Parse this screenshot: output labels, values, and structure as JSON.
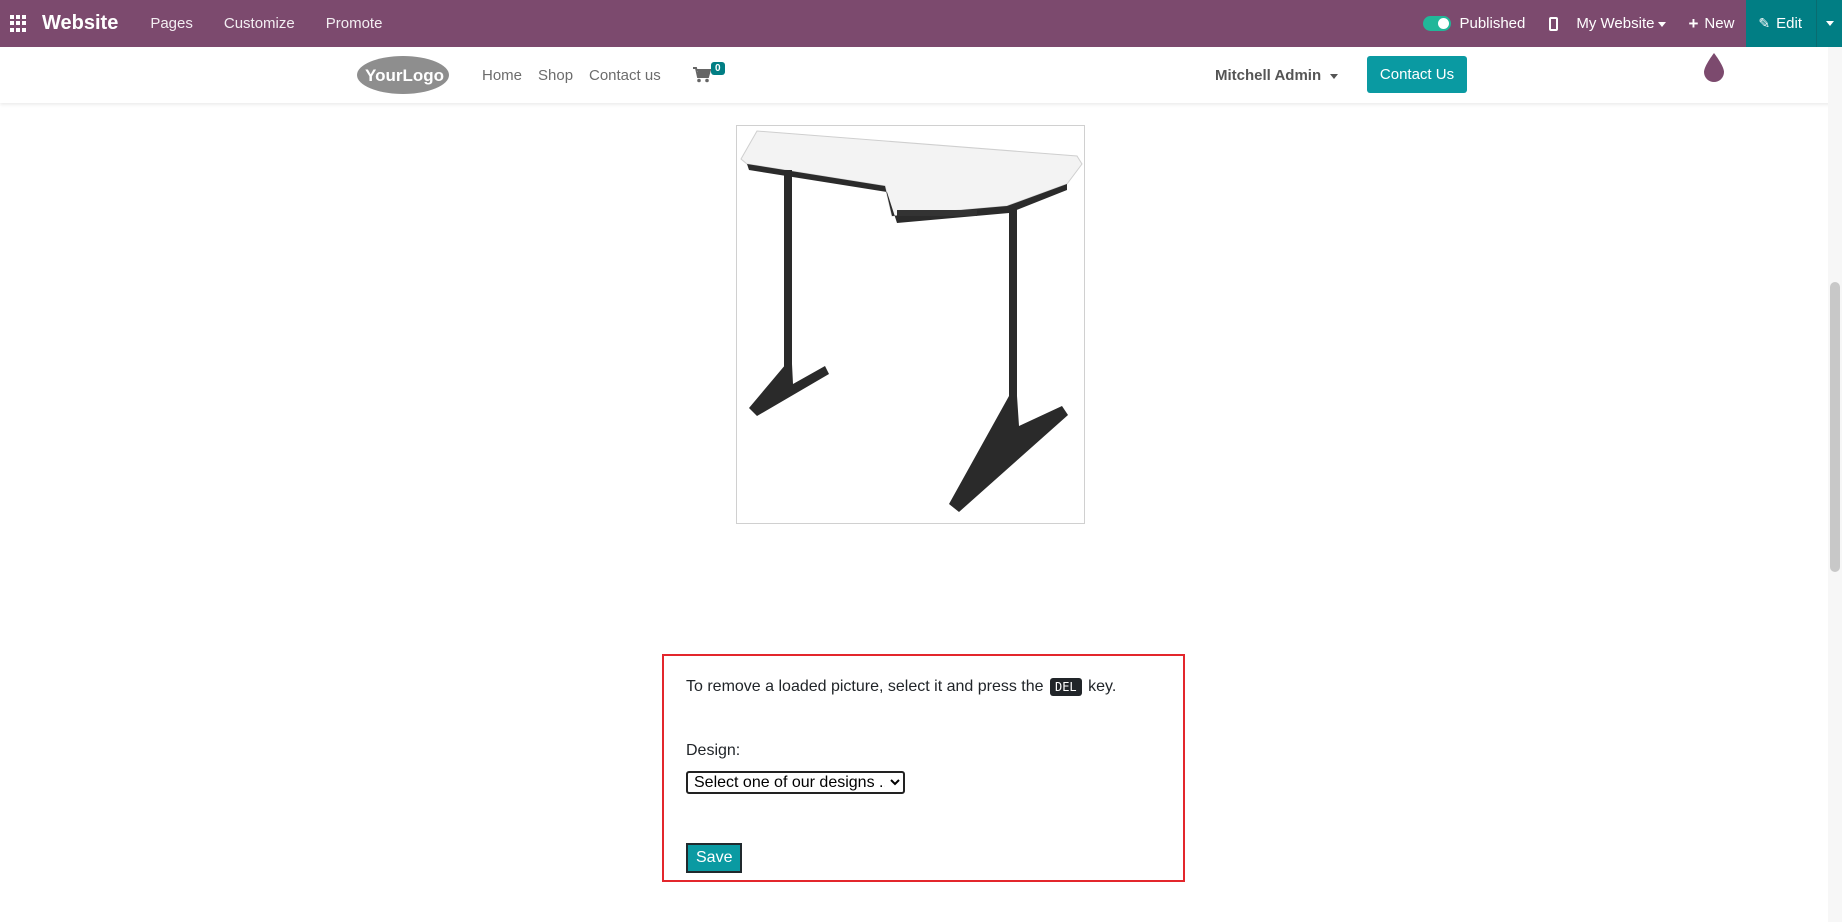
{
  "topbar": {
    "brand": "Website",
    "menus": [
      "Pages",
      "Customize",
      "Promote"
    ],
    "published_label": "Published",
    "my_website": "My Website",
    "new_label": "New",
    "edit_label": "Edit",
    "bg_color": "#7c4a6e",
    "edit_color": "#017e84"
  },
  "sitenav": {
    "logo_text": "YourLogo",
    "links": [
      "Home",
      "Shop",
      "Contact us"
    ],
    "cart_count": "0",
    "user": "Mitchell Admin",
    "contact_button": "Contact Us"
  },
  "form": {
    "hint_before": "To remove a loaded picture, select it and press the",
    "hint_key": "DEL",
    "hint_after": "key.",
    "design_label": "Design:",
    "design_selected": "Select one of our designs ...",
    "save_label": "Save"
  }
}
